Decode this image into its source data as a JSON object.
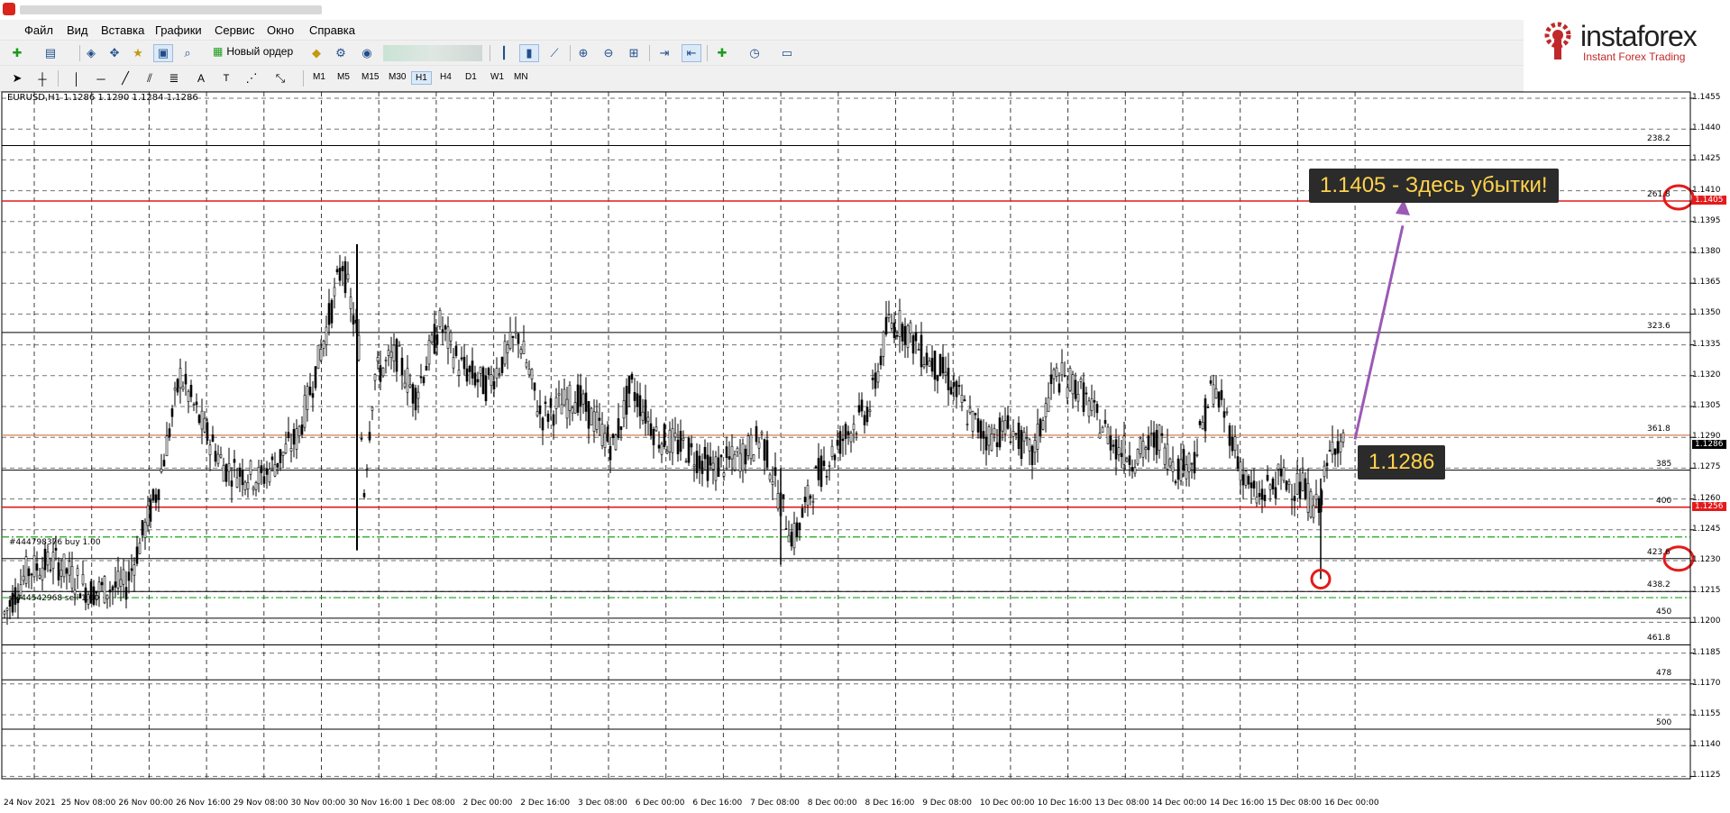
{
  "menu": [
    "Файл",
    "Вид",
    "Вставка",
    "Графики",
    "Сервис",
    "Окно",
    "Справка"
  ],
  "toolbar": {
    "new_order_label": "Новый ордер"
  },
  "timeframes": [
    "M1",
    "M5",
    "M15",
    "M30",
    "H1",
    "H4",
    "D1",
    "W1",
    "MN"
  ],
  "selected_timeframe": "H1",
  "logo": {
    "name": "instaforex",
    "tagline": "Instant Forex Trading"
  },
  "chart": {
    "symbol_line": "EURUSD,H1  1.1286 1.1290 1.1284 1.1286",
    "price_axis": [
      "1.1455",
      "1.1440",
      "1.1425",
      "1.1410",
      "1.1395",
      "1.1380",
      "1.1365",
      "1.1350",
      "1.1335",
      "1.1320",
      "1.1305",
      "1.1290",
      "1.1275",
      "1.1260",
      "1.1245",
      "1.1230",
      "1.1215",
      "1.1200",
      "1.1185",
      "1.1170",
      "1.1155",
      "1.1140",
      "1.1125"
    ],
    "dates": [
      "24 Nov 2021",
      "25 Nov 08:00",
      "26 Nov 00:00",
      "26 Nov 16:00",
      "29 Nov 08:00",
      "30 Nov 00:00",
      "30 Nov 16:00",
      "1 Dec 08:00",
      "2 Dec 00:00",
      "2 Dec 16:00",
      "3 Dec 08:00",
      "6 Dec 00:00",
      "6 Dec 16:00",
      "7 Dec 08:00",
      "8 Dec 00:00",
      "8 Dec 16:00",
      "9 Dec 08:00",
      "10 Dec 00:00",
      "10 Dec 16:00",
      "13 Dec 08:00",
      "14 Dec 00:00",
      "14 Dec 16:00",
      "15 Dec 08:00",
      "16 Dec 00:00"
    ],
    "fibo_levels": [
      {
        "label": "238.2",
        "price": 1.1432
      },
      {
        "label": "261.8",
        "price": 1.1405
      },
      {
        "label": "323.6",
        "price": 1.1341
      },
      {
        "label": "361.8",
        "price": 1.1291
      },
      {
        "label": "385",
        "price": 1.1274
      },
      {
        "label": "400",
        "price": 1.1256
      },
      {
        "label": "423.6",
        "price": 1.1231
      },
      {
        "label": "438.2",
        "price": 1.1215
      },
      {
        "label": "450",
        "price": 1.1202
      },
      {
        "label": "461.8",
        "price": 1.1189
      },
      {
        "label": "478",
        "price": 1.1172
      },
      {
        "label": "500",
        "price": 1.1148
      }
    ],
    "price_tags": [
      {
        "text": "1.1405",
        "color": "#e31b1b"
      },
      {
        "text": "1.1286",
        "color": "#000000"
      },
      {
        "text": "1.1256",
        "color": "#e31b1b"
      }
    ],
    "order_labels": [
      "#444798376 buy 1.00",
      "#444542968 sell 1.00"
    ],
    "callout_target": "1.1405 - Здесь убытки!",
    "callout_current": "1.1286",
    "colors": {
      "red_line": "#e31b1b",
      "order_line": "#1aa31a",
      "arrow": "#9b59b6",
      "circle": "#e31b1b"
    }
  }
}
